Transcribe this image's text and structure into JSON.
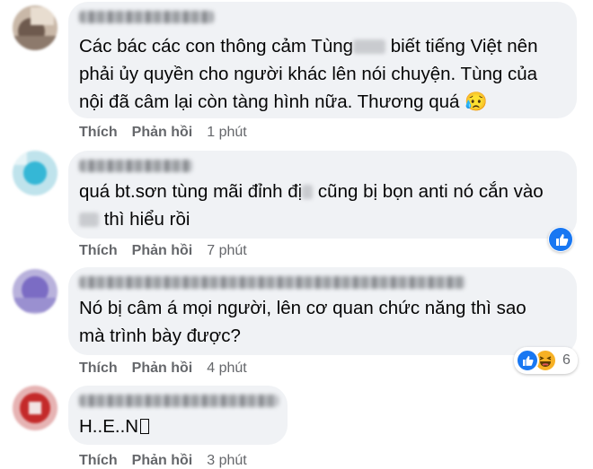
{
  "comments": [
    {
      "text_before": "Các bác các con thông cảm Tùng",
      "text_after": " biết tiếng Việt nên\nphải ủy quyền cho người khác lên nói chuyện. Tùng của\nnội đã câm lại còn tàng hình nữa. Thương quá ",
      "emoji": "😥",
      "like_label": "Thích",
      "reply_label": "Phản hồi",
      "time": "1 phút"
    },
    {
      "text_before": "quá bt.sơn tùng mãi đỉnh đị",
      "text_middle": " cũng bị bọn anti nó cắn vào\n",
      "text_after": " thì hiểu rồi",
      "like_label": "Thích",
      "reply_label": "Phản hồi",
      "time": "7 phút",
      "reaction_count": ""
    },
    {
      "text": "Nó bị câm á mọi người, lên cơ quan chức năng thì sao\nmà trình bày được?",
      "like_label": "Thích",
      "reply_label": "Phản hồi",
      "time": "4 phút",
      "reaction_count": "6"
    },
    {
      "text": "H..E..N",
      "like_label": "Thích",
      "reply_label": "Phản hồi",
      "time": "3 phút"
    }
  ],
  "colors": {
    "bubble": "#f0f2f5",
    "meta": "#65676b",
    "like_blue": "#1877f2",
    "haha_yellow": "#f7b125"
  },
  "icons": [
    "like-reaction-icon",
    "haha-reaction-icon",
    "sad-face-emoji"
  ]
}
